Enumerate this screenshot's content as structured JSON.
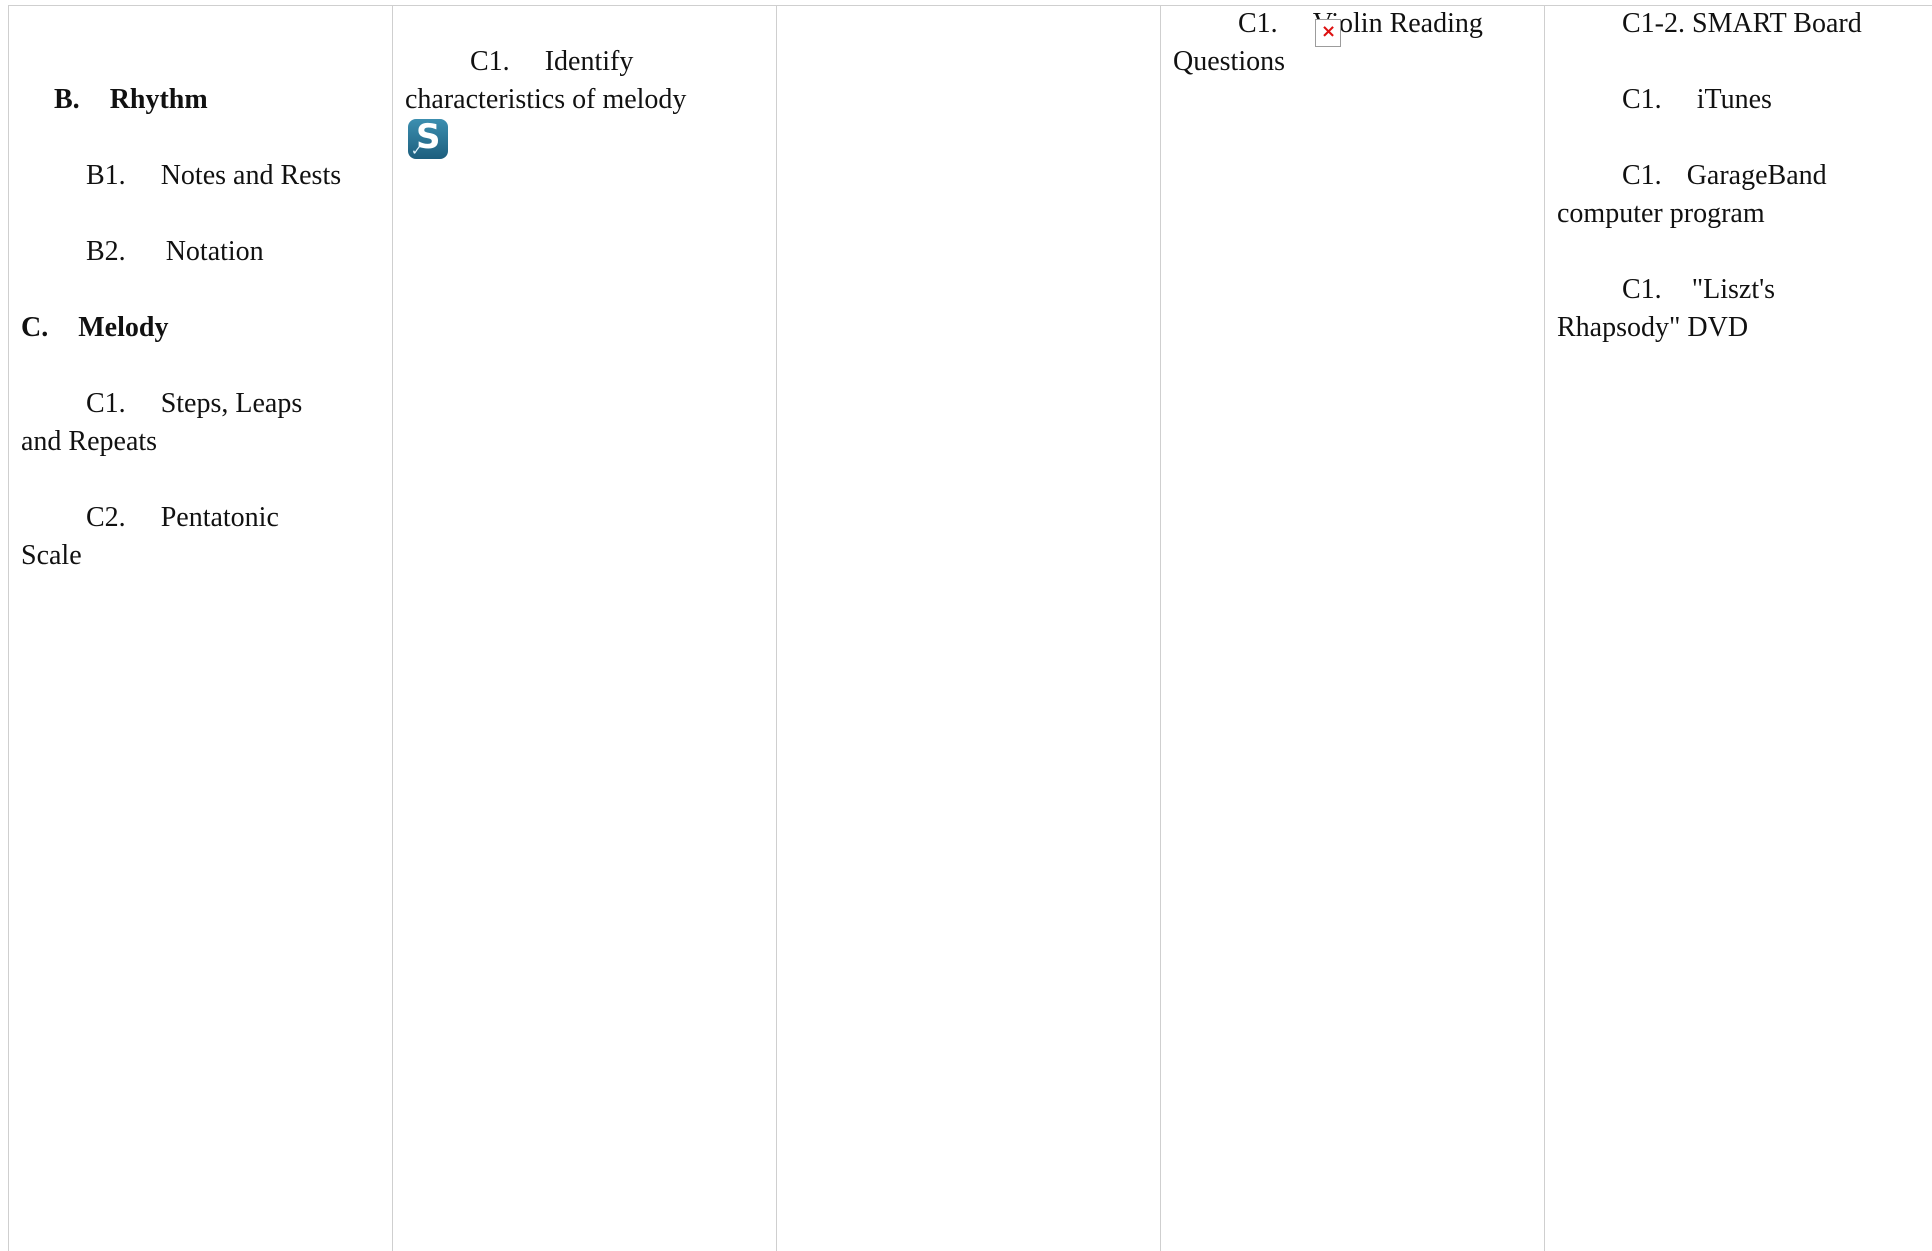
{
  "col1": {
    "section_b_label": "B.",
    "section_b_title": "Rhythm",
    "b1_code": "B1.",
    "b1_text": "Notes and Rests",
    "b2_code": "B2.",
    "b2_text": "Notation",
    "section_c_label": "C.",
    "section_c_title": "Melody",
    "c1_code": "C1.",
    "c1_text_a": "Steps, Leaps",
    "c1_text_b": "and Repeats",
    "c2_code": "C2.",
    "c2_text_a": "Pentatonic",
    "c2_text_b": "Scale"
  },
  "col2": {
    "code": "C1.",
    "text_a": "Identify",
    "text_b": "characteristics of melody",
    "icon": "smartboard-check-icon"
  },
  "col4": {
    "code": "C1.",
    "text_a": "Violin Reading",
    "text_b": "Questions",
    "icon": "broken-image-icon"
  },
  "col5": {
    "r1": "C1-2. SMART Board",
    "r2_code": "C1.",
    "r2_text": "iTunes",
    "r3_code": "C1.",
    "r3_text_a": "GarageBand",
    "r3_text_b": "computer program",
    "r4_code": "C1.",
    "r4_text_a": "\"Liszt's",
    "r4_text_b": "Rhapsody\" DVD"
  }
}
